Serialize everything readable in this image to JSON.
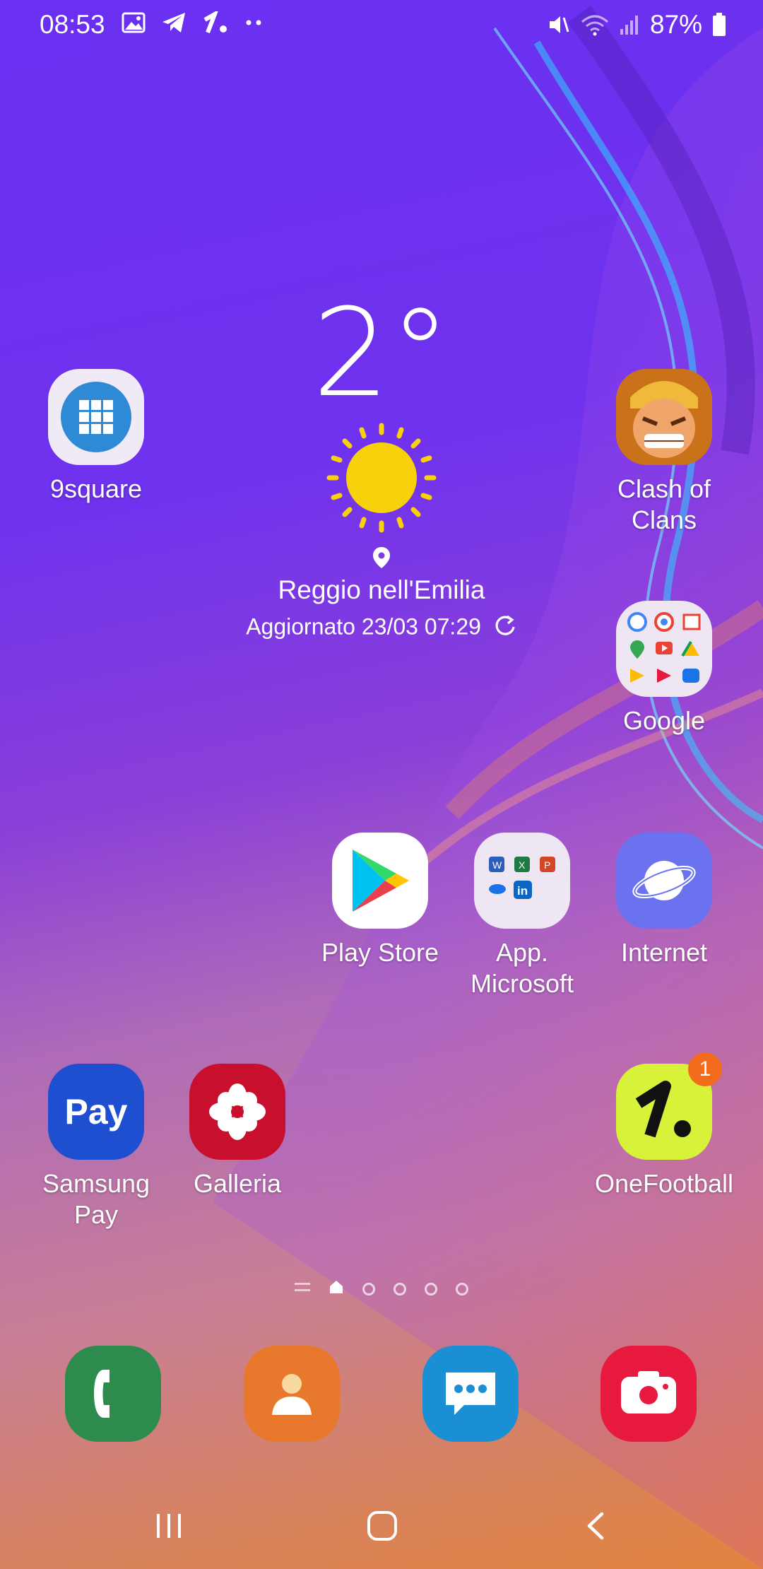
{
  "status": {
    "time": "08:53",
    "battery": "87%",
    "icons_left": [
      "image-icon",
      "telegram-icon",
      "onefootball-notif-icon",
      "more-dots-icon"
    ],
    "icons_right": [
      "mute-icon",
      "wifi-icon",
      "signal-icon",
      "battery-icon"
    ]
  },
  "weather": {
    "temp": "2°",
    "location": "Reggio nell'Emilia",
    "updated": "Aggiornato 23/03 07:29",
    "condition_icon": "sun-icon"
  },
  "apps": {
    "ninesquare": "9square",
    "clash": "Clash of Clans",
    "google": "Google",
    "playstore": "Play Store",
    "microsoft": "App. Microsoft",
    "internet": "Internet",
    "samsungpay": "Samsung Pay",
    "samsungpay_icon_text": "Pay",
    "galleria": "Galleria",
    "onefootball": "OneFootball",
    "onefootball_badge": "1"
  },
  "pager": {
    "pages": 5,
    "current": 1
  },
  "dock": [
    "phone-icon",
    "contacts-icon",
    "messages-icon",
    "camera-icon"
  ],
  "colors": {
    "phone": "#2e8b4e",
    "contacts": "#e8782c",
    "messages": "#1a8fd3",
    "camera": "#e8193e",
    "galleria": "#c8102e",
    "samsungpay": "#1e4fd0",
    "internet": "#6a72f0",
    "onefootball": "#d8f23a"
  }
}
